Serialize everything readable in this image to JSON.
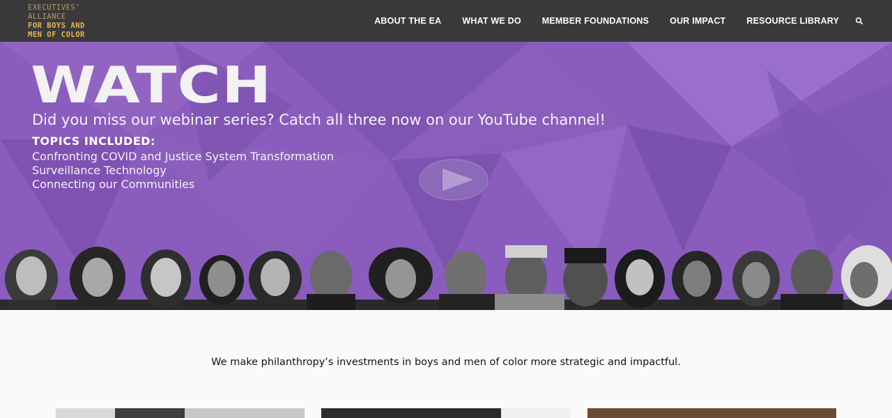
{
  "header": {
    "logo_line1": "EXECUTIVES'",
    "logo_line2": "ALLIANCE",
    "logo_line3": "FOR BOYS AND",
    "logo_line4": "MEN OF COLOR",
    "nav": [
      "ABOUT THE EA",
      "WHAT WE DO",
      "MEMBER FOUNDATIONS",
      "OUR IMPACT",
      "RESOURCE LIBRARY"
    ],
    "search_icon": "search-icon"
  },
  "hero": {
    "title": "WATCH",
    "subtitle": "Did you miss our webinar series? Catch all three now on our YouTube channel!",
    "topics_title": "TOPICS INCLUDED:",
    "topics": [
      "Confronting COVID and Justice System Transformation",
      "Surveillance Technology",
      "Connecting our Communities"
    ],
    "play_icon": "play-icon",
    "accent_color": "#8a5fb8"
  },
  "tagline": "We make philanthropy’s investments in boys and men of color more strategic and impactful."
}
